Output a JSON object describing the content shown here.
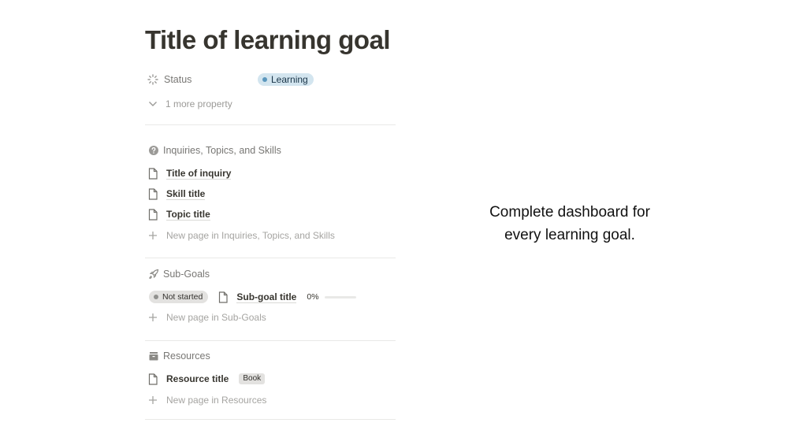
{
  "page": {
    "title": "Title of learning goal"
  },
  "properties": {
    "status_label": "Status",
    "status_value": "Learning",
    "more_label": "1 more property",
    "icons": {
      "status": "loader-icon",
      "more": "chevron-down-icon"
    }
  },
  "sections": {
    "inquiries": {
      "title": "Inquiries, Topics, and Skills",
      "icon": "question-circle-icon",
      "items": [
        "Title of inquiry",
        "Skill title",
        "Topic title"
      ],
      "new_page": "New page in Inquiries, Topics, and Skills"
    },
    "subgoals": {
      "title": "Sub-Goals",
      "icon": "rocket-icon",
      "item": {
        "status": "Not started",
        "title": "Sub-goal title",
        "progress_label": "0%",
        "progress": 0
      },
      "new_page": "New page in Sub-Goals"
    },
    "resources": {
      "title": "Resources",
      "icon": "archive-icon",
      "item": {
        "title": "Resource title",
        "tag": "Book"
      },
      "new_page": "New page in Resources"
    }
  },
  "caption": {
    "line1": "Complete dashboard for",
    "line2": "every learning goal."
  },
  "colors": {
    "text": "#37352f",
    "muted": "#787774",
    "learning_bg": "#d3e5ef",
    "learning_dot": "#5b97bd",
    "not_started_bg": "#e3e2e0"
  }
}
